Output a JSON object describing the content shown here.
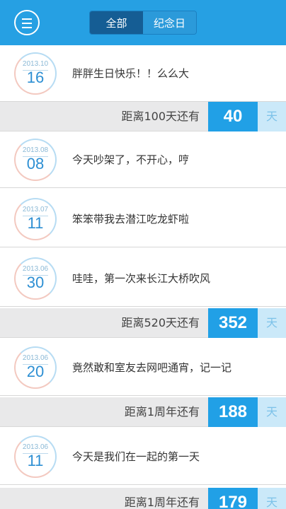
{
  "header": {
    "menu_icon": "menu-icon",
    "tabs": [
      {
        "label": "全部",
        "active": true
      },
      {
        "label": "纪念日",
        "active": false
      }
    ],
    "color": "#26a0e3"
  },
  "entries": [
    {
      "year_month": "2013.10",
      "day": "16",
      "text": "胖胖生日快乐！！么么大"
    },
    {
      "year_month": "2013.08",
      "day": "08",
      "text": "今天吵架了，不开心，哼"
    },
    {
      "year_month": "2013.07",
      "day": "11",
      "text": "笨笨带我去潜江吃龙虾啦"
    },
    {
      "year_month": "2013.06",
      "day": "30",
      "text": "哇哇，第一次来长江大桥吹风"
    },
    {
      "year_month": "2013.06",
      "day": "20",
      "text": "竟然敢和室友去网吧通宵，记一记"
    },
    {
      "year_month": "2013.06",
      "day": "11",
      "text": "今天是我们在一起的第一天"
    }
  ],
  "countdowns": [
    {
      "label": "距离100天还有",
      "value": "40",
      "unit": "天"
    },
    {
      "label": "距离520天还有",
      "value": "352",
      "unit": "天"
    },
    {
      "label": "距离1周年还有",
      "value": "188",
      "unit": "天"
    },
    {
      "label": "距离1周年还有",
      "value": "179",
      "unit": "天"
    }
  ]
}
